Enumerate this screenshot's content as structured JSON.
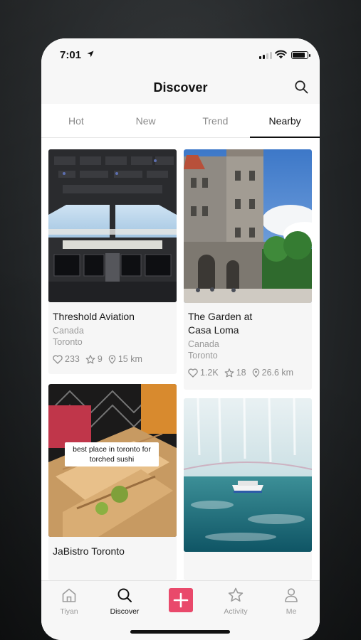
{
  "status_bar": {
    "time": "7:01"
  },
  "header": {
    "title": "Discover"
  },
  "tabs": [
    {
      "label": "Hot"
    },
    {
      "label": "New"
    },
    {
      "label": "Trend"
    },
    {
      "label": "Nearby",
      "active": true
    }
  ],
  "feed": {
    "cards": [
      {
        "name": "Threshold Aviation",
        "country": "Canada",
        "city": "Toronto",
        "likes": "233",
        "stars": "9",
        "distance": "15 km",
        "image": "cockpit-photo"
      },
      {
        "name": "The Garden at Casa Loma",
        "name_line1": "The Garden at",
        "name_line2": "Casa Loma",
        "country": "Canada",
        "city": "Toronto",
        "likes": "1.2K",
        "stars": "18",
        "distance": "26.6 km",
        "image": "castle-photo"
      },
      {
        "name": "JaBistro Toronto",
        "image": "sushi-photo",
        "caption": "best place in toronto for torched sushi"
      },
      {
        "name": "",
        "image": "waterfall-boat-photo"
      }
    ]
  },
  "bottom_nav": {
    "items": [
      {
        "label": "Tiyan",
        "icon": "home-icon"
      },
      {
        "label": "Discover",
        "icon": "search-icon",
        "active": true
      },
      {
        "label": "",
        "icon": "plus-icon"
      },
      {
        "label": "Activity",
        "icon": "star-icon"
      },
      {
        "label": "Me",
        "icon": "person-icon"
      }
    ]
  },
  "colors": {
    "accent": "#e9496b",
    "active_text": "#111111",
    "inactive_text": "#8a8a8a"
  }
}
